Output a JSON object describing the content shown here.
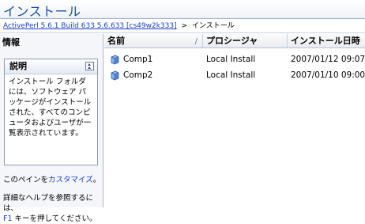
{
  "window": {
    "title": "インストール"
  },
  "breadcrumb": {
    "link": "ActivePerl 5.6.1 Build 633 5.6.633 [cs49w2k333]",
    "separator": ">",
    "current": "インストール"
  },
  "sidebar": {
    "header": "情報",
    "box": {
      "title": "説明",
      "body": "インストール フォルダには、ソフトウェア パッケージがインストールされた、すべてのコンピュータおよびユーザが一覧表示されています。"
    },
    "customize": {
      "prefix": "このペインを",
      "link": "カスタマイズ",
      "suffix": "。"
    },
    "help": {
      "line1": "詳細なヘルプを参照するには、",
      "key": "F1",
      "line2": " キーを押してください。"
    }
  },
  "list": {
    "columns": {
      "name": "名前",
      "sort_indicator": "/",
      "provider": "プロシージャ",
      "date": "インストール日時"
    },
    "rows": [
      {
        "icon": "package-icon",
        "name": "Comp1",
        "provider": "Local Install",
        "date": "2007/01/12 09:07"
      },
      {
        "icon": "package-icon",
        "name": "Comp2",
        "provider": "Local Install",
        "date": "2007/01/10 09:00"
      }
    ]
  },
  "colors": {
    "title": "#1f4fa3",
    "link": "#1a3ecc",
    "sidebar_bg": "#f4f6fa"
  }
}
